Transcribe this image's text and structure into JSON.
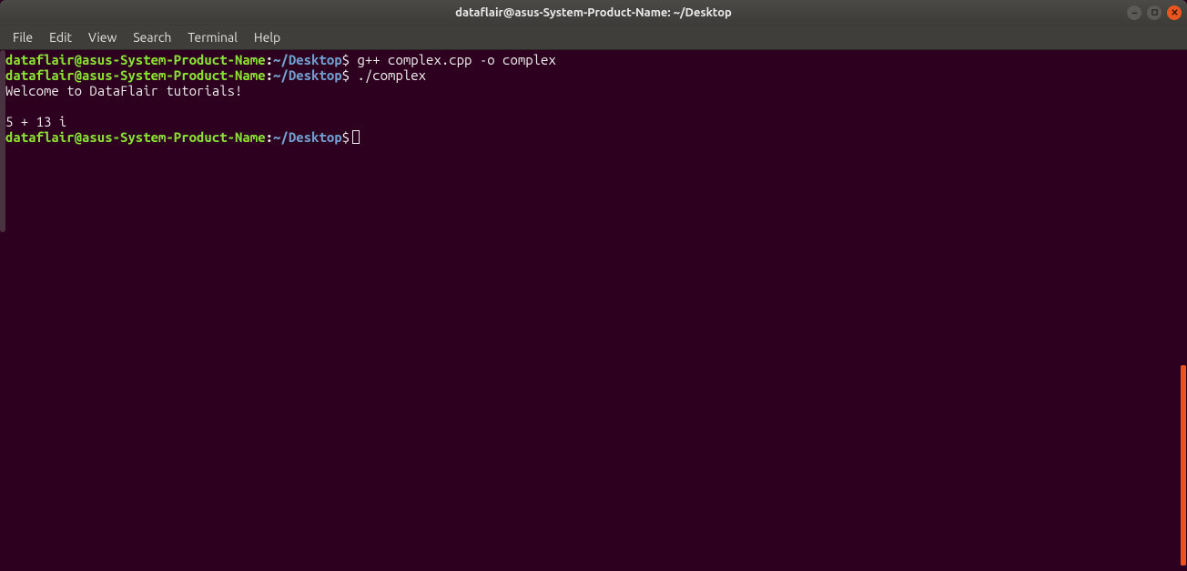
{
  "window": {
    "title": "dataflair@asus-System-Product-Name: ~/Desktop"
  },
  "menubar": {
    "items": [
      "File",
      "Edit",
      "View",
      "Search",
      "Terminal",
      "Help"
    ]
  },
  "prompt": {
    "user_host": "dataflair@asus-System-Product-Name",
    "colon": ":",
    "path_tilde": "~/",
    "path_dir": "Desktop",
    "dollar": "$"
  },
  "lines": [
    {
      "type": "prompt",
      "command": " g++ complex.cpp -o complex"
    },
    {
      "type": "prompt",
      "command": " ./complex"
    },
    {
      "type": "output",
      "text": "Welcome to DataFlair tutorials!"
    },
    {
      "type": "blank"
    },
    {
      "type": "output",
      "text": "5 + 13 i"
    },
    {
      "type": "prompt",
      "command": "",
      "cursor": true
    }
  ]
}
